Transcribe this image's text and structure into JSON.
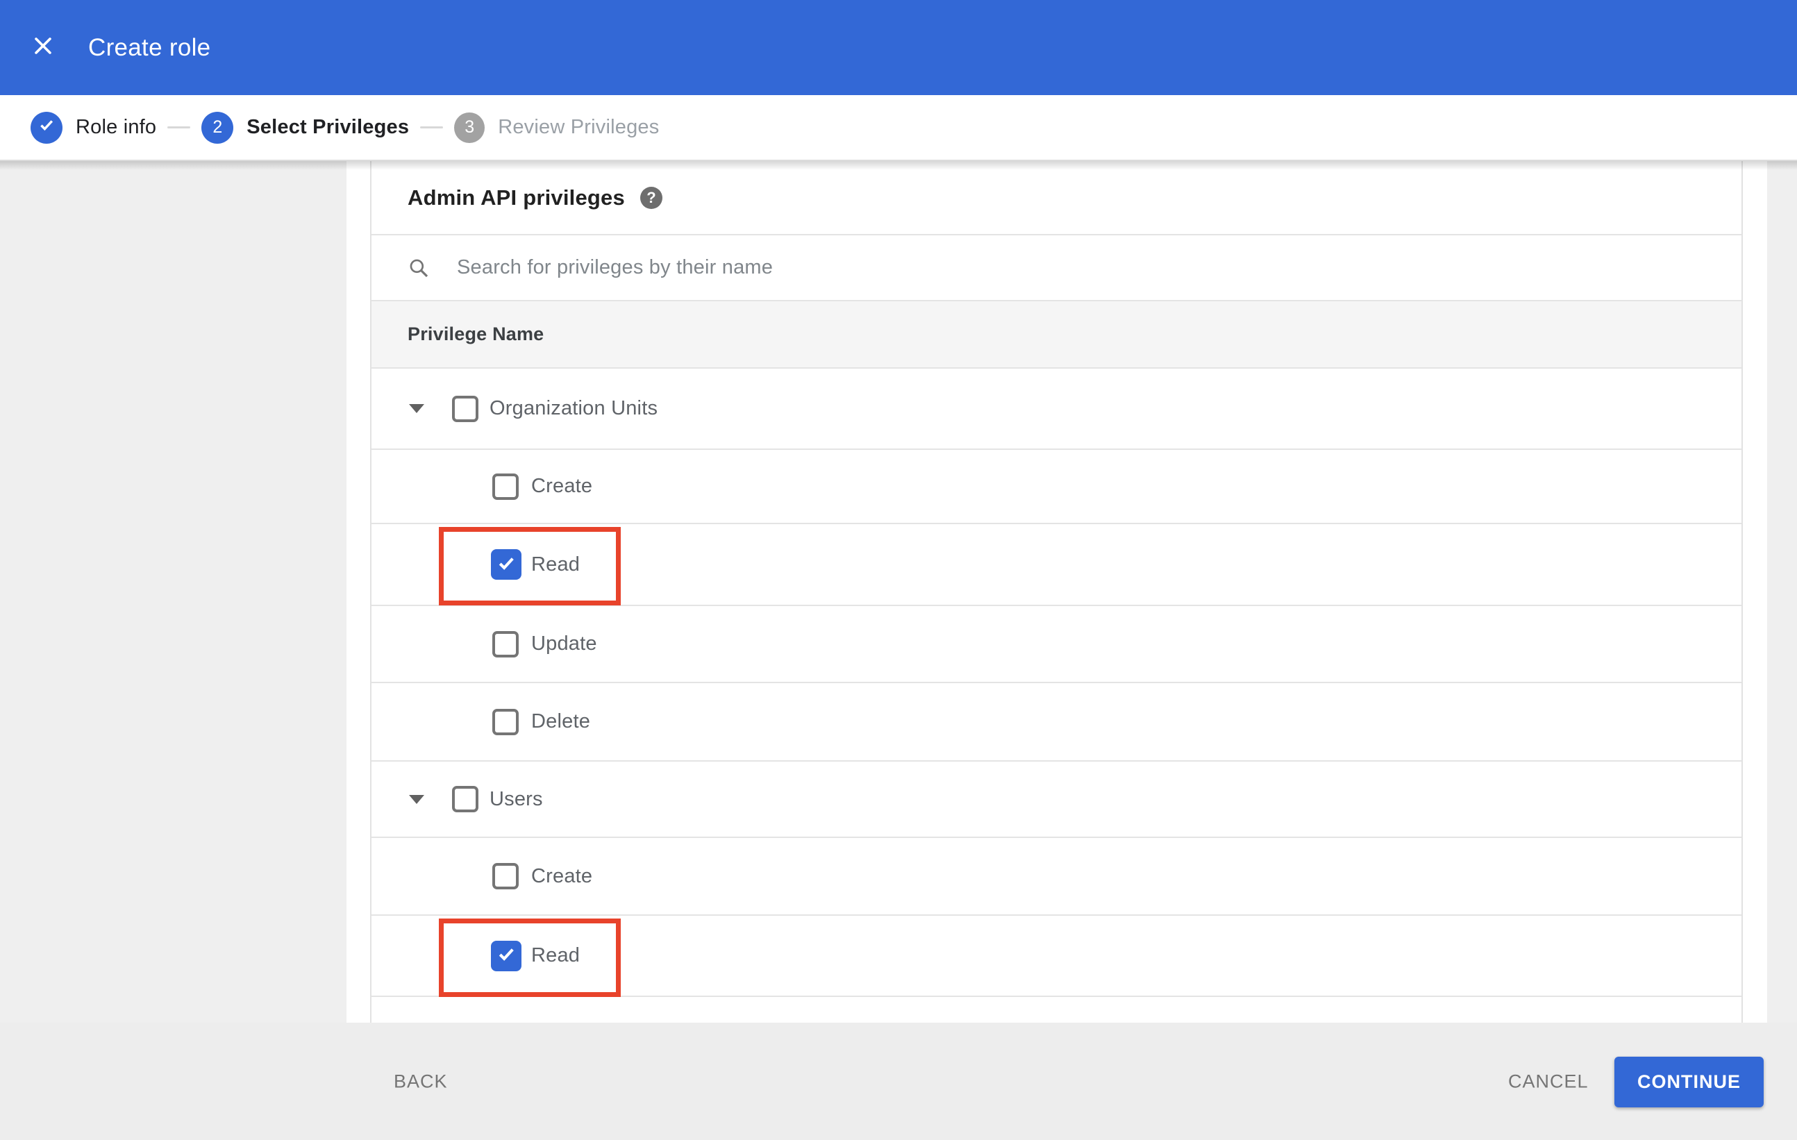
{
  "colors": {
    "accent_blue": "#3368d6",
    "annotation_red": "#e8432b",
    "inactive_step_gray": "#a2a2a2",
    "page_background": "#efefef",
    "table_header_background": "#f5f5f5",
    "divider": "#e4e4e4"
  },
  "header": {
    "title": "Create role"
  },
  "stepper": {
    "steps": [
      {
        "number": "1",
        "label": "Role info",
        "state": "complete"
      },
      {
        "number": "2",
        "label": "Select Privileges",
        "state": "active"
      },
      {
        "number": "3",
        "label": "Review Privileges",
        "state": "upcoming"
      }
    ]
  },
  "content": {
    "heading": "Admin API privileges",
    "search_placeholder": "Search for privileges by their name",
    "table_header": "Privilege Name",
    "rows": [
      {
        "label": "Organization Units",
        "level": 0,
        "expanded": true,
        "checked": false,
        "highlighted": false
      },
      {
        "label": "Create",
        "level": 1,
        "expanded": null,
        "checked": false,
        "highlighted": false
      },
      {
        "label": "Read",
        "level": 1,
        "expanded": null,
        "checked": true,
        "highlighted": true
      },
      {
        "label": "Update",
        "level": 1,
        "expanded": null,
        "checked": false,
        "highlighted": false
      },
      {
        "label": "Delete",
        "level": 1,
        "expanded": null,
        "checked": false,
        "highlighted": false
      },
      {
        "label": "Users",
        "level": 0,
        "expanded": true,
        "checked": false,
        "highlighted": false
      },
      {
        "label": "Create",
        "level": 1,
        "expanded": null,
        "checked": false,
        "highlighted": false
      },
      {
        "label": "Read",
        "level": 1,
        "expanded": null,
        "checked": true,
        "highlighted": true
      }
    ]
  },
  "footer": {
    "back_label": "BACK",
    "cancel_label": "CANCEL",
    "continue_label": "CONTINUE"
  }
}
